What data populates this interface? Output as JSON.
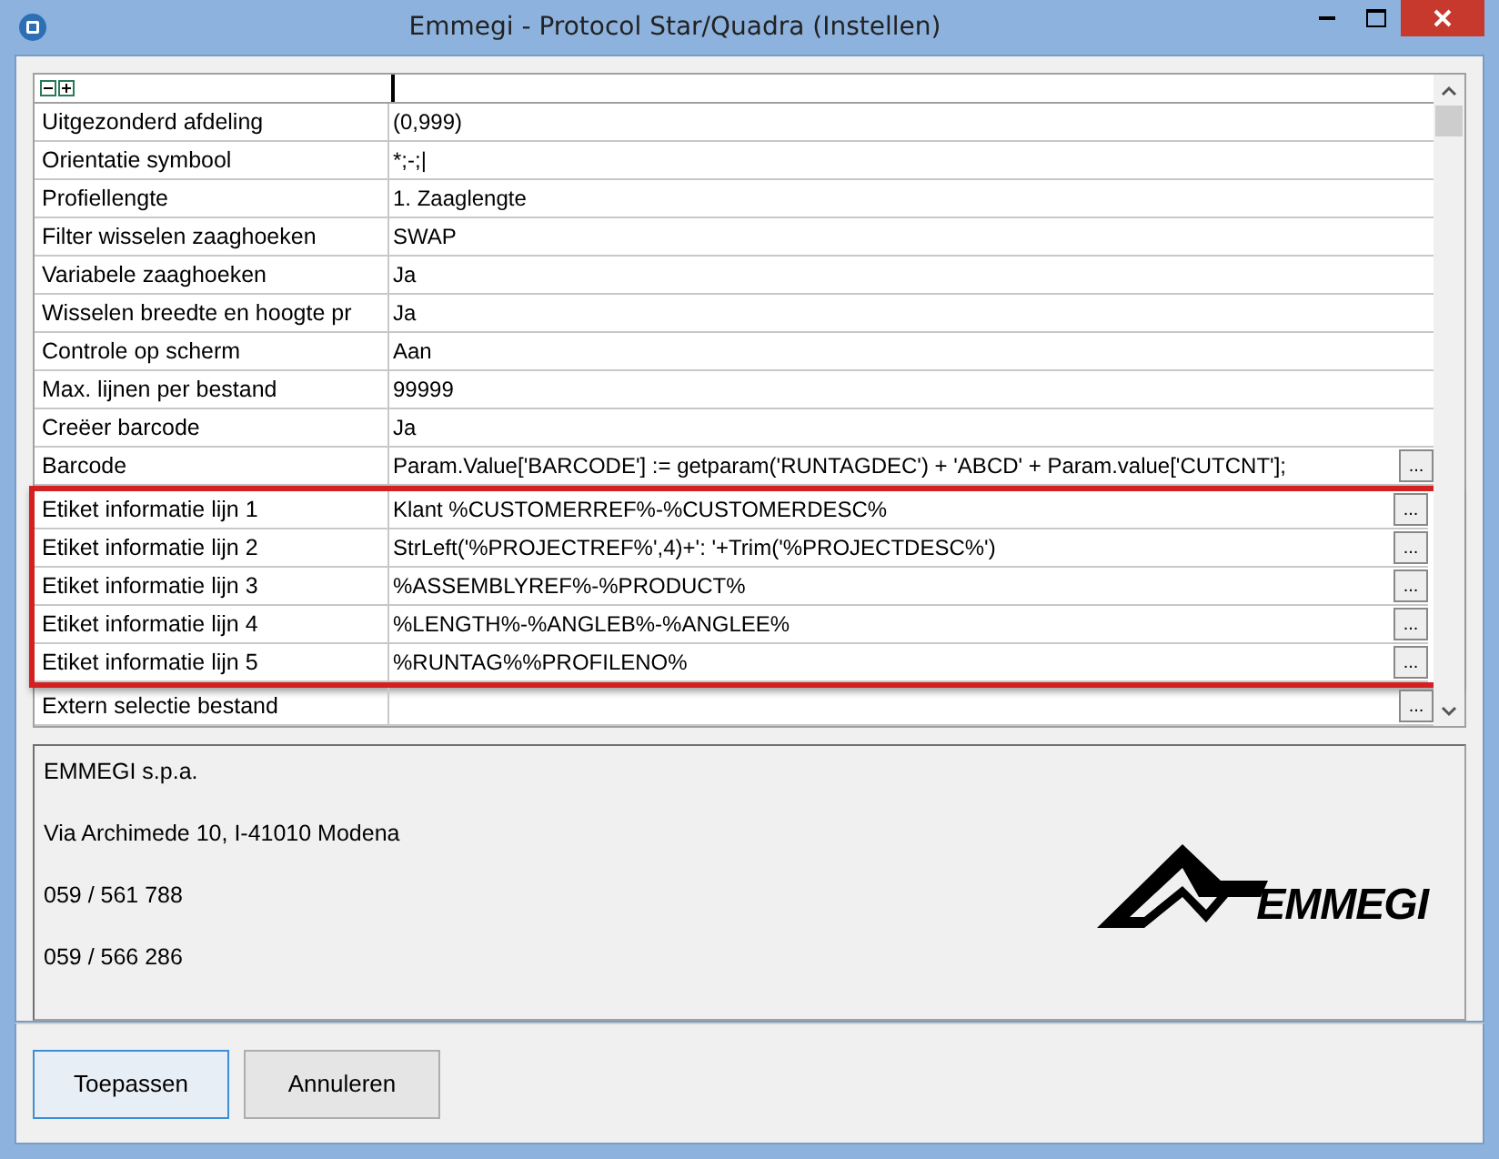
{
  "window": {
    "title": "Emmegi - Protocol Star/Quadra (Instellen)"
  },
  "properties": [
    {
      "name": "Uitgezonderd afdeling",
      "value": "(0,999)",
      "has_button": false,
      "highlighted": false
    },
    {
      "name": "Orientatie symbool",
      "value": "*;-;|",
      "has_button": false,
      "highlighted": false
    },
    {
      "name": "Profiellengte",
      "value": "1. Zaaglengte",
      "has_button": false,
      "highlighted": false
    },
    {
      "name": "Filter wisselen zaaghoeken",
      "value": "SWAP",
      "has_button": false,
      "highlighted": false
    },
    {
      "name": "Variabele zaaghoeken",
      "value": "Ja",
      "has_button": false,
      "highlighted": false
    },
    {
      "name": "Wisselen breedte en hoogte pr",
      "value": "Ja",
      "has_button": false,
      "highlighted": false
    },
    {
      "name": "Controle op scherm",
      "value": "Aan",
      "has_button": false,
      "highlighted": false
    },
    {
      "name": "Max. lijnen per bestand",
      "value": "99999",
      "has_button": false,
      "highlighted": false
    },
    {
      "name": "Creëer barcode",
      "value": "Ja",
      "has_button": false,
      "highlighted": false
    },
    {
      "name": "Barcode",
      "value": "Param.Value['BARCODE'] := getparam('RUNTAGDEC') + 'ABCD' + Param.value['CUTCNT'];",
      "has_button": true,
      "button_label": "...",
      "highlighted": false
    },
    {
      "name": "Etiket informatie lijn 1",
      "value": "Klant %CUSTOMERREF%-%CUSTOMERDESC%",
      "has_button": true,
      "button_label": "...",
      "highlighted": true
    },
    {
      "name": "Etiket informatie lijn 2",
      "value": "StrLeft('%PROJECTREF%',4)+': '+Trim('%PROJECTDESC%')",
      "has_button": true,
      "button_label": "...",
      "highlighted": true
    },
    {
      "name": "Etiket informatie lijn 3",
      "value": "%ASSEMBLYREF%-%PRODUCT%",
      "has_button": true,
      "button_label": "...",
      "highlighted": true
    },
    {
      "name": "Etiket informatie lijn 4",
      "value": "%LENGTH%-%ANGLEB%-%ANGLEE%",
      "has_button": true,
      "button_label": "...",
      "highlighted": true
    },
    {
      "name": "Etiket informatie lijn 5",
      "value": "%RUNTAG%%PROFILENO%",
      "has_button": true,
      "button_label": "...",
      "highlighted": true
    },
    {
      "name": "Extern selectie bestand",
      "has_button": true,
      "button_label": "...",
      "highlighted": false
    }
  ],
  "info": {
    "lines": [
      "EMMEGI s.p.a.",
      "Via Archimede 10, I-41010 Modena",
      "059 / 561 788",
      "059 / 566 286"
    ],
    "logo_text": "EMMEGI"
  },
  "buttons": [
    {
      "label": "Toepassen",
      "default": true
    },
    {
      "label": "Annuleren",
      "default": false
    }
  ]
}
